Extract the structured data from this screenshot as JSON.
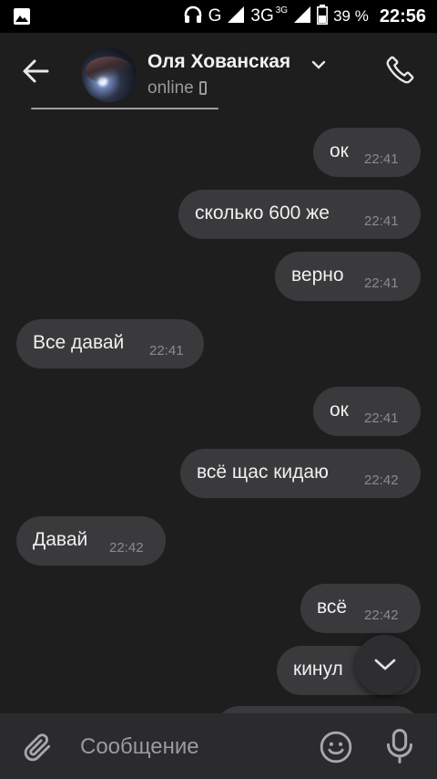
{
  "status_bar": {
    "network_g": "G",
    "network_3g": "3G",
    "network_3g_small": "3G",
    "battery": "39 %",
    "time": "22:56",
    "icons": [
      "image-icon",
      "headphones-icon",
      "signal-icon",
      "battery-icon"
    ]
  },
  "header": {
    "contact_name": "Оля Хованская",
    "status": "online",
    "icons": [
      "back-arrow-icon",
      "chevron-down-icon",
      "phone-icon",
      "mobile-device-icon"
    ]
  },
  "messages": [
    {
      "text": "ок",
      "time": "22:41",
      "side": "out"
    },
    {
      "text": "сколько 600 же",
      "time": "22:41",
      "side": "out"
    },
    {
      "text": "верно",
      "time": "22:41",
      "side": "out"
    },
    {
      "text": "Все давай",
      "time": "22:41",
      "side": "in"
    },
    {
      "text": "ок",
      "time": "22:41",
      "side": "out"
    },
    {
      "text": "всё щас кидаю",
      "time": "22:42",
      "side": "out"
    },
    {
      "text": "Давай",
      "time": "22:42",
      "side": "in"
    },
    {
      "text": "всё",
      "time": "22:42",
      "side": "out"
    },
    {
      "text": "кинул",
      "time": "",
      "side": "out"
    }
  ],
  "input": {
    "placeholder": "Сообщение",
    "icons": [
      "paperclip-icon",
      "emoji-icon",
      "microphone-icon"
    ]
  },
  "colors": {
    "background": "#1e1e1f",
    "bubble": "#3a3a3c",
    "input_bar": "#2b2b2d",
    "time_text": "#8b8b8d"
  }
}
